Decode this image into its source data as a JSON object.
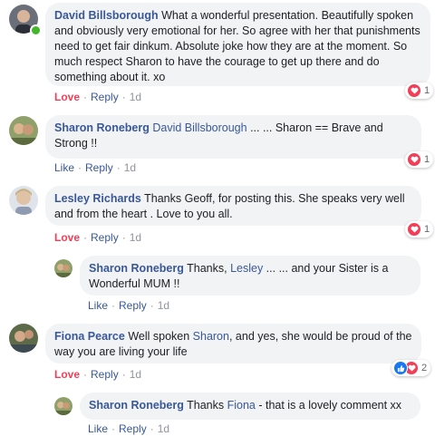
{
  "comments": [
    {
      "author": "David Billsborough",
      "text": "What a wonderful presentation. Beautifully spoken and obviously very emotional for her. So agree with her that punishments need to get fair dinkum. Absolute joke how they are at the moment. So much respect Sharon to have the courage to get up there and do something about it. xo",
      "action1": "Love",
      "action2": "Reply",
      "time": "1d",
      "reaction_count": "1"
    },
    {
      "author": "Sharon Roneberg",
      "mention": "David Billsborough",
      "text": " ... ... Sharon == Brave and Strong !!",
      "action1": "Like",
      "action2": "Reply",
      "time": "1d",
      "reaction_count": "1"
    },
    {
      "author": "Lesley Richards",
      "text": "Thanks Geoff, for posting this. She speaks very well and from the heart . Love to you all.",
      "action1": "Love",
      "action2": "Reply",
      "time": "1d",
      "reaction_count": "1"
    },
    {
      "author": "Sharon Roneberg",
      "text_before": "Thanks, ",
      "mention": "Lesley",
      "text_after": " ... ... and your Sister is a Wonderful MUM !!",
      "action1": "Like",
      "action2": "Reply",
      "time": "1d"
    },
    {
      "author": "Fiona Pearce",
      "text_before": "Well spoken ",
      "mention": "Sharon",
      "text_after": ", and yes, she would be proud of the way you are living your life",
      "action1": "Love",
      "action2": "Reply",
      "time": "1d",
      "reaction_count": "2"
    },
    {
      "author": "Sharon Roneberg",
      "text_before": "Thanks ",
      "mention": "Fiona",
      "text_after": " - that is a lovely comment xx",
      "action1": "Like",
      "action2": "Reply",
      "time": "1d"
    }
  ],
  "separator": "·",
  "colors": {
    "link": "#385898",
    "love": "#f33e58",
    "like_blue": "#1877f2",
    "bubble": "#f2f3f5",
    "meta": "#90949c",
    "online": "#42b72a"
  },
  "icons": [
    "heart-reaction-icon",
    "like-reaction-icon",
    "online-status-icon"
  ]
}
